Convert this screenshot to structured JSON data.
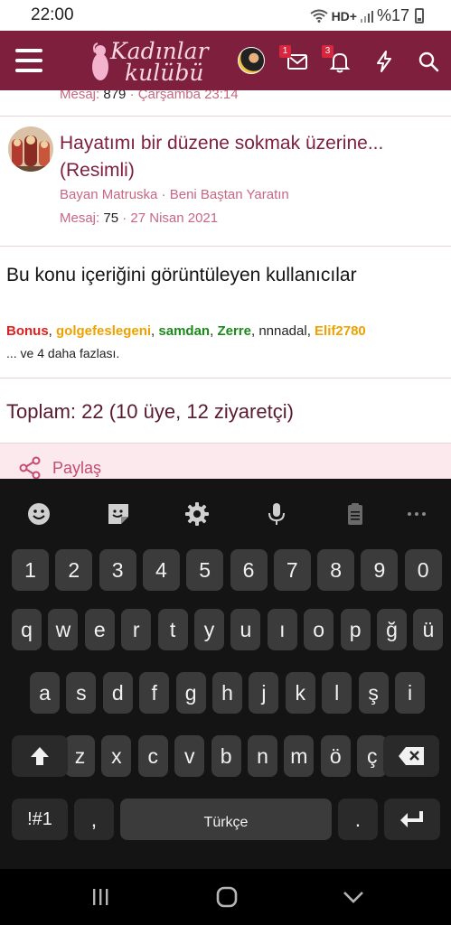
{
  "status": {
    "time": "22:00",
    "network": "HD+",
    "battery": "%17"
  },
  "header": {
    "logo_line1": "Kadınlar",
    "logo_line2": "kulübü",
    "messages_badge": "1",
    "notifications_badge": "3",
    "brand_color": "#7e1f3d"
  },
  "previous_item": {
    "meta_label": "Mesaj:",
    "meta_count": "879",
    "meta_date": "· Çarşamba 23:14"
  },
  "thread": {
    "title": "Hayatımı bir düzene sokmak üzerine... (Resimli)",
    "author": "Bayan Matruska",
    "forum": "· Beni Baştan Yaratın",
    "meta_label": "Mesaj:",
    "meta_count": "75",
    "meta_date": "· 27 Nisan 2021"
  },
  "viewers": {
    "title": "Bu konu içeriğini görüntüleyen kullanıcılar",
    "users": [
      {
        "name": "Bonus",
        "color": "#e0201f"
      },
      {
        "name": "golgefeslegeni",
        "color": "#f0a100"
      },
      {
        "name": "samdan",
        "color": "#1b8a1b"
      },
      {
        "name": "Zerre",
        "color": "#1b8a1b"
      },
      {
        "name": "nnnadal",
        "color": "#222222"
      },
      {
        "name": "Elif2780",
        "color": "#f0a100"
      }
    ],
    "more": "... ve 4 daha fazlası."
  },
  "totals": "Toplam: 22 (10 üye, 12 ziyaretçi)",
  "share": {
    "label": "Paylaş"
  },
  "keyboard": {
    "row_numbers": [
      "1",
      "2",
      "3",
      "4",
      "5",
      "6",
      "7",
      "8",
      "9",
      "0"
    ],
    "row1": [
      "q",
      "w",
      "e",
      "r",
      "t",
      "y",
      "u",
      "ı",
      "o",
      "p",
      "ğ",
      "ü"
    ],
    "row2": [
      "a",
      "s",
      "d",
      "f",
      "g",
      "h",
      "j",
      "k",
      "l",
      "ş",
      "i"
    ],
    "row3": [
      "z",
      "x",
      "c",
      "v",
      "b",
      "n",
      "m",
      "ö",
      "ç"
    ],
    "symbols_label": "!#1",
    "comma": ",",
    "space_label": "Türkçe",
    "period": "."
  }
}
